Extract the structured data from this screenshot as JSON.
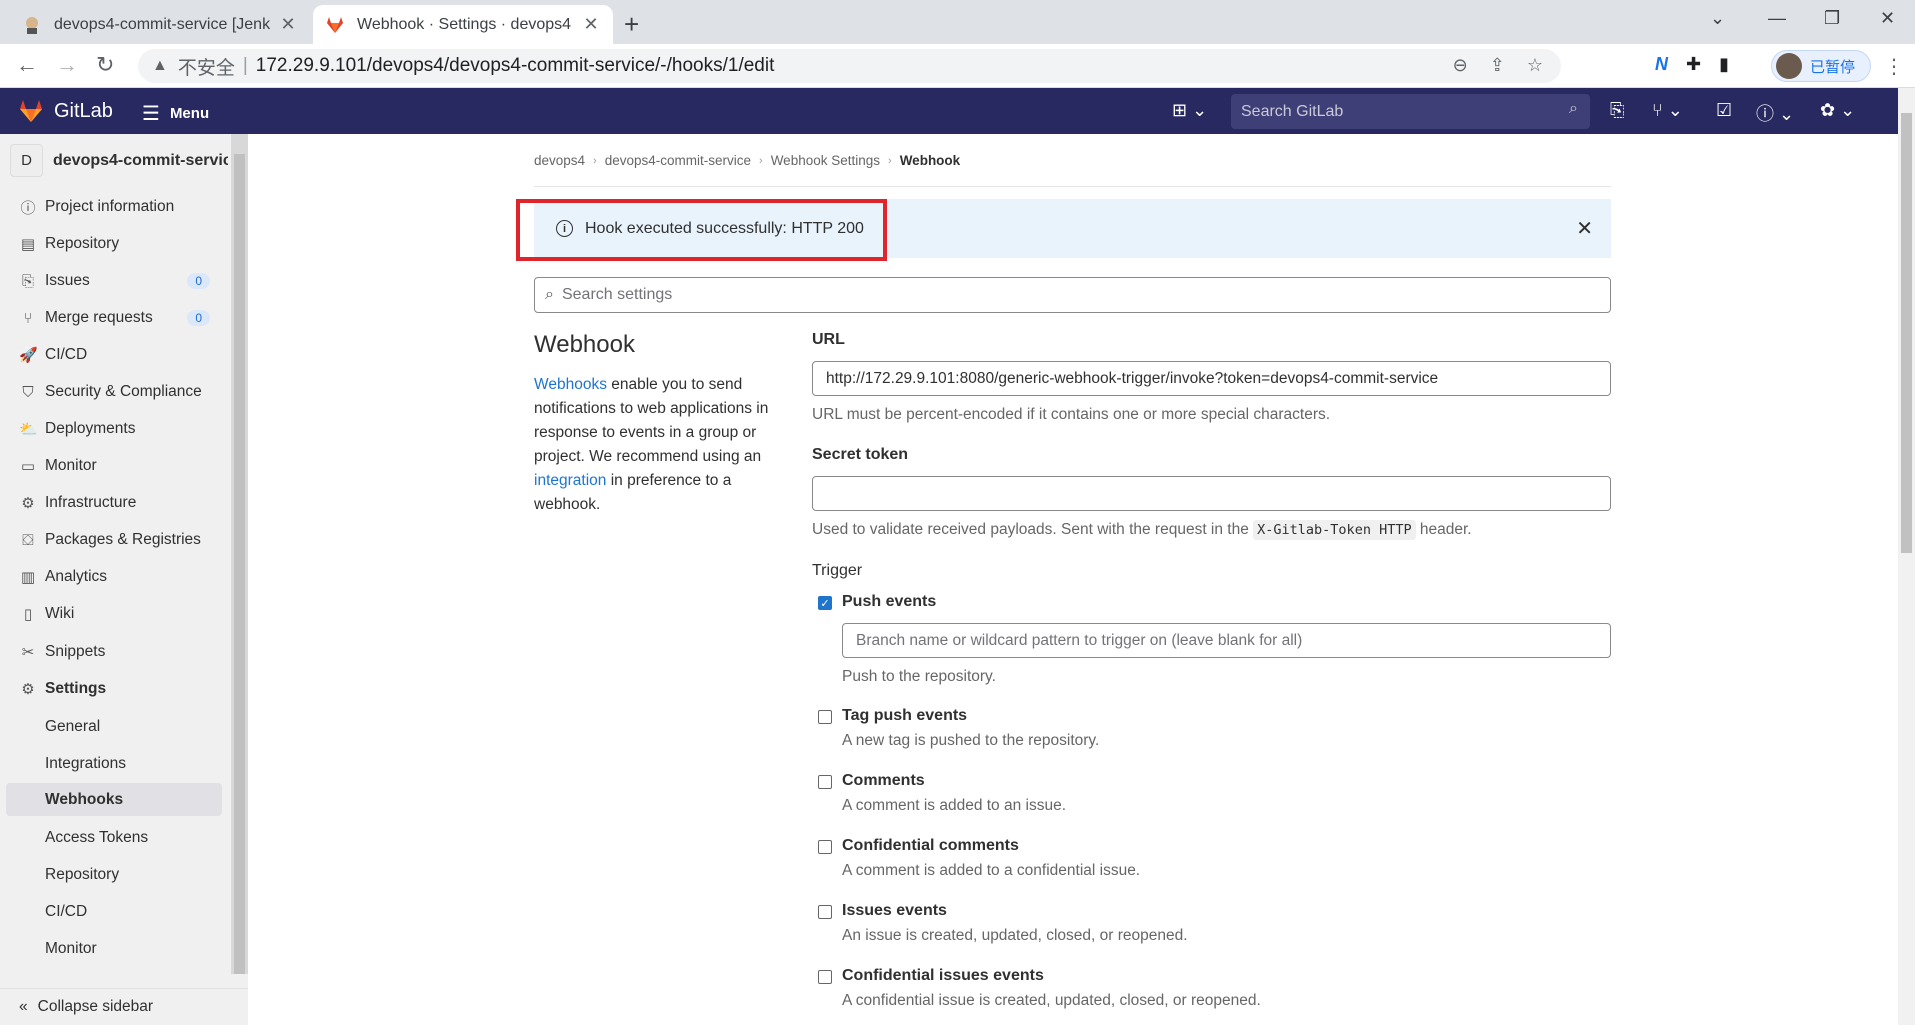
{
  "browser": {
    "tabs": [
      {
        "title": "devops4-commit-service [Jenk",
        "active": false
      },
      {
        "title": "Webhook · Settings · devops4",
        "active": true
      }
    ],
    "address": {
      "insecure_label": "不安全",
      "separator": "|",
      "url": "172.29.9.101/devops4/devops4-commit-service/-/hooks/1/edit"
    },
    "profile_label": "已暂停"
  },
  "gitlab": {
    "brand": "GitLab",
    "menu_label": "Menu",
    "search_placeholder": "Search GitLab"
  },
  "sidebar": {
    "project_initial": "D",
    "project_name": "devops4-commit-service",
    "items": [
      {
        "label": "Project information",
        "icon": "info-icon"
      },
      {
        "label": "Repository",
        "icon": "book-icon"
      },
      {
        "label": "Issues",
        "icon": "issues-icon",
        "count": "0"
      },
      {
        "label": "Merge requests",
        "icon": "merge-icon",
        "count": "0"
      },
      {
        "label": "CI/CD",
        "icon": "rocket-icon"
      },
      {
        "label": "Security & Compliance",
        "icon": "shield-icon"
      },
      {
        "label": "Deployments",
        "icon": "deploy-icon"
      },
      {
        "label": "Monitor",
        "icon": "monitor-icon"
      },
      {
        "label": "Infrastructure",
        "icon": "cloud-gear-icon"
      },
      {
        "label": "Packages & Registries",
        "icon": "package-icon"
      },
      {
        "label": "Analytics",
        "icon": "chart-icon"
      },
      {
        "label": "Wiki",
        "icon": "wiki-icon"
      },
      {
        "label": "Snippets",
        "icon": "scissors-icon"
      },
      {
        "label": "Settings",
        "icon": "gear-icon"
      }
    ],
    "settings_sub": [
      "General",
      "Integrations",
      "Webhooks",
      "Access Tokens",
      "Repository",
      "CI/CD",
      "Monitor"
    ],
    "active_sub": "Webhooks",
    "collapse_label": "Collapse sidebar"
  },
  "breadcrumb": [
    "devops4",
    "devops4-commit-service",
    "Webhook Settings",
    "Webhook"
  ],
  "alert": {
    "message": "Hook executed successfully: HTTP 200"
  },
  "search_settings_placeholder": "Search settings",
  "webhook": {
    "heading": "Webhook",
    "desc_link1": "Webhooks",
    "desc_part1": " enable you to send notifications to web applications in response to events in a group or project. We recommend using an ",
    "desc_link2": "integration",
    "desc_part2": " in preference to a webhook.",
    "url_label": "URL",
    "url_value": "http://172.29.9.101:8080/generic-webhook-trigger/invoke?token=devops4-commit-service",
    "url_help": "URL must be percent-encoded if it contains one or more special characters.",
    "secret_label": "Secret token",
    "secret_help_pre": "Used to validate received payloads. Sent with the request in the ",
    "secret_help_code": "X-Gitlab-Token HTTP",
    "secret_help_post": " header.",
    "trigger_label": "Trigger",
    "branch_placeholder": "Branch name or wildcard pattern to trigger on (leave blank for all)",
    "triggers": [
      {
        "label": "Push events",
        "help": "Push to the repository.",
        "checked": true
      },
      {
        "label": "Tag push events",
        "help": "A new tag is pushed to the repository.",
        "checked": false
      },
      {
        "label": "Comments",
        "help": "A comment is added to an issue.",
        "checked": false
      },
      {
        "label": "Confidential comments",
        "help": "A comment is added to a confidential issue.",
        "checked": false
      },
      {
        "label": "Issues events",
        "help": "An issue is created, updated, closed, or reopened.",
        "checked": false
      },
      {
        "label": "Confidential issues events",
        "help": "A confidential issue is created, updated, closed, or reopened.",
        "checked": false
      }
    ]
  }
}
